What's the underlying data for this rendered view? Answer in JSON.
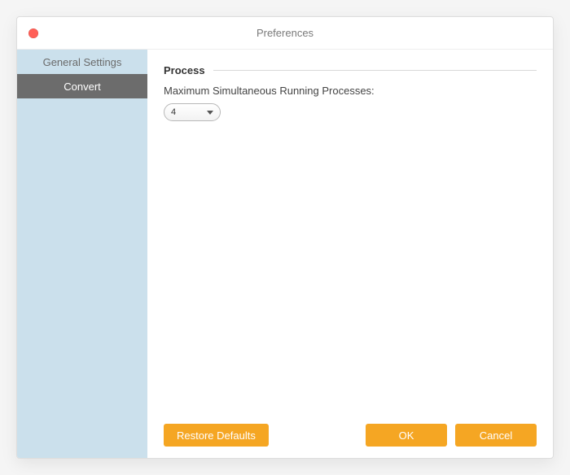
{
  "window": {
    "title": "Preferences"
  },
  "sidebar": {
    "items": [
      {
        "label": "General Settings",
        "active": false
      },
      {
        "label": "Convert",
        "active": true
      }
    ]
  },
  "main": {
    "section_title": "Process",
    "field_label": "Maximum Simultaneous Running Processes:",
    "select_value": "4"
  },
  "footer": {
    "restore_defaults": "Restore Defaults",
    "ok": "OK",
    "cancel": "Cancel"
  }
}
